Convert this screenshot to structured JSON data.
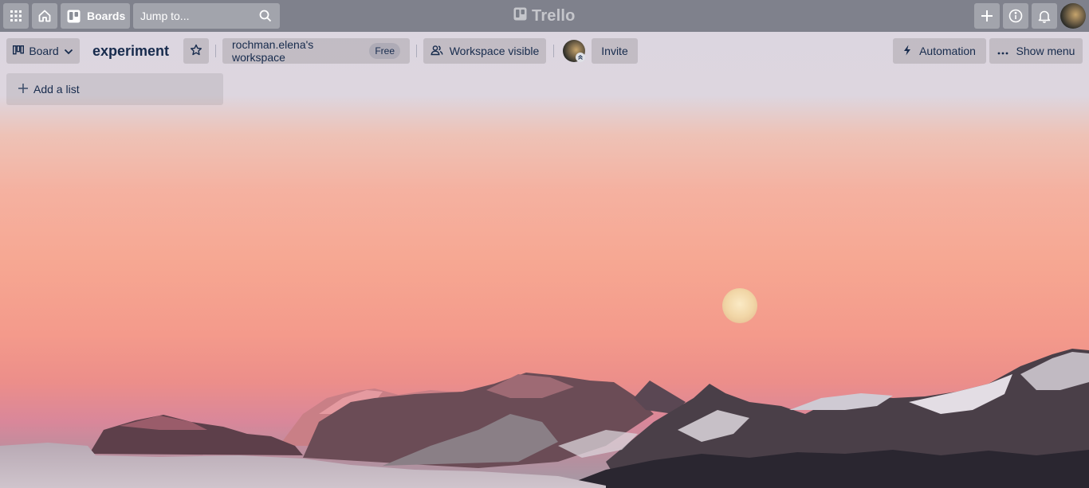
{
  "app": {
    "name": "Trello"
  },
  "topbar": {
    "apps_icon": "grid-icon",
    "home_icon": "home-icon",
    "boards_label": "Boards",
    "search_placeholder": "Jump to...",
    "create_icon": "plus-icon",
    "info_icon": "info-icon",
    "notifications_icon": "bell-icon"
  },
  "board": {
    "view_label": "Board",
    "title": "experiment",
    "workspace_name": "rochman.elena's workspace",
    "workspace_plan": "Free",
    "visibility_label": "Workspace visible",
    "invite_label": "Invite",
    "automation_label": "Automation",
    "menu_label": "Show menu",
    "add_list_label": "Add a list"
  },
  "colors": {
    "header_bg": "#767a84",
    "text_dark": "#172b4d",
    "sky_top": "#ddd6df",
    "sky_mid": "#f6a792",
    "moon": "#f3dfb0"
  }
}
